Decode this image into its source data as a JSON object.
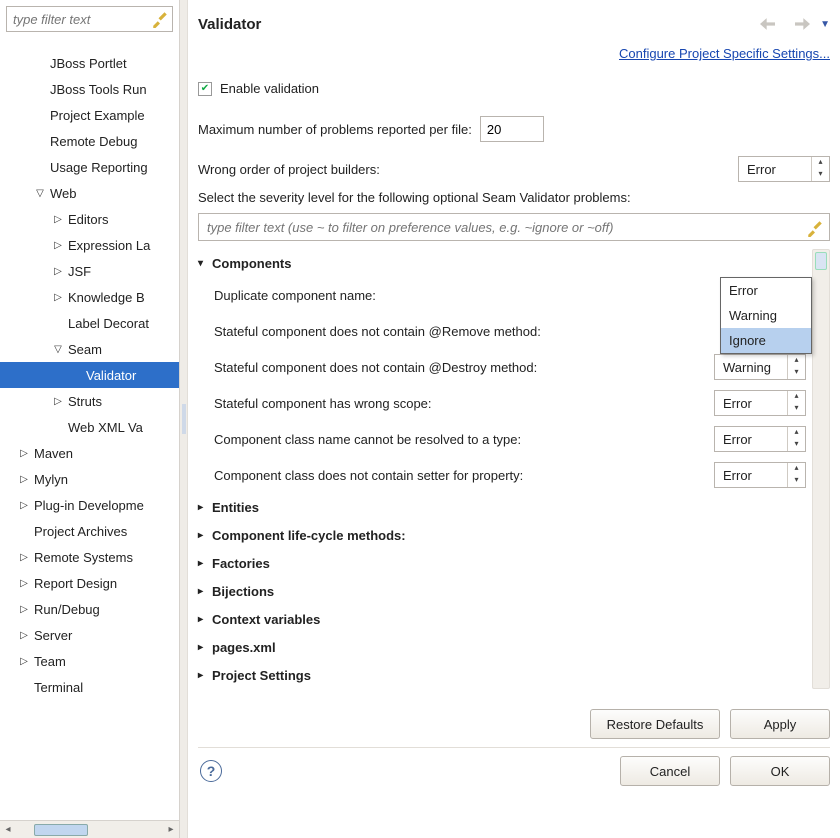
{
  "left": {
    "filter_placeholder": "type filter text",
    "tree": [
      {
        "label": "JBoss Portlet",
        "depth": 1,
        "arrow": ""
      },
      {
        "label": "JBoss Tools Run",
        "depth": 1,
        "arrow": ""
      },
      {
        "label": "Project Example",
        "depth": 1,
        "arrow": ""
      },
      {
        "label": "Remote Debug",
        "depth": 1,
        "arrow": ""
      },
      {
        "label": "Usage Reporting",
        "depth": 1,
        "arrow": ""
      },
      {
        "label": "Web",
        "depth": 1,
        "arrow": "▽"
      },
      {
        "label": "Editors",
        "depth": 2,
        "arrow": "▷"
      },
      {
        "label": "Expression La",
        "depth": 2,
        "arrow": "▷"
      },
      {
        "label": "JSF",
        "depth": 2,
        "arrow": "▷"
      },
      {
        "label": "Knowledge B",
        "depth": 2,
        "arrow": "▷"
      },
      {
        "label": "Label Decorat",
        "depth": 2,
        "arrow": ""
      },
      {
        "label": "Seam",
        "depth": 2,
        "arrow": "▽"
      },
      {
        "label": "Validator",
        "depth": 3,
        "arrow": "",
        "selected": true
      },
      {
        "label": "Struts",
        "depth": 2,
        "arrow": "▷"
      },
      {
        "label": "Web XML Va",
        "depth": 2,
        "arrow": ""
      },
      {
        "label": "Maven",
        "depth": 0,
        "arrow": "▷"
      },
      {
        "label": "Mylyn",
        "depth": 0,
        "arrow": "▷"
      },
      {
        "label": "Plug-in Developme",
        "depth": 0,
        "arrow": "▷"
      },
      {
        "label": "Project Archives",
        "depth": 0,
        "arrow": ""
      },
      {
        "label": "Remote Systems",
        "depth": 0,
        "arrow": "▷"
      },
      {
        "label": "Report Design",
        "depth": 0,
        "arrow": "▷"
      },
      {
        "label": "Run/Debug",
        "depth": 0,
        "arrow": "▷"
      },
      {
        "label": "Server",
        "depth": 0,
        "arrow": "▷"
      },
      {
        "label": "Team",
        "depth": 0,
        "arrow": "▷"
      },
      {
        "label": "Terminal",
        "depth": 0,
        "arrow": ""
      }
    ]
  },
  "header": {
    "title": "Validator",
    "configure_link": "Configure Project Specific Settings..."
  },
  "form": {
    "enable_label": "Enable validation",
    "enable_checked": true,
    "max_label": "Maximum number of problems reported per file:",
    "max_value": "20",
    "wrong_order_label": "Wrong order of project builders:",
    "wrong_order_value": "Error",
    "severity_label": "Select the severity level for the following optional Seam Validator problems:",
    "filter2_placeholder": "type filter text (use ~ to filter on preference values, e.g. ~ignore or ~off)"
  },
  "dropdown_options": [
    "Error",
    "Warning",
    "Ignore"
  ],
  "settings": {
    "open_section": "Components",
    "rows": [
      {
        "name": "Duplicate component name:",
        "value": ""
      },
      {
        "name": "Stateful component does not contain @Remove method:",
        "value": ""
      },
      {
        "name": "Stateful component does not contain @Destroy method:",
        "value": "Warning"
      },
      {
        "name": "Stateful component has wrong scope:",
        "value": "Error"
      },
      {
        "name": "Component class name cannot be resolved to a type:",
        "value": "Error"
      },
      {
        "name": "Component class does not contain setter for property:",
        "value": "Error"
      }
    ],
    "closed_sections": [
      "Entities",
      "Component life-cycle methods:",
      "Factories",
      "Bijections",
      "Context variables",
      "pages.xml",
      "Project Settings"
    ]
  },
  "buttons": {
    "restore": "Restore Defaults",
    "apply": "Apply",
    "cancel": "Cancel",
    "ok": "OK"
  }
}
